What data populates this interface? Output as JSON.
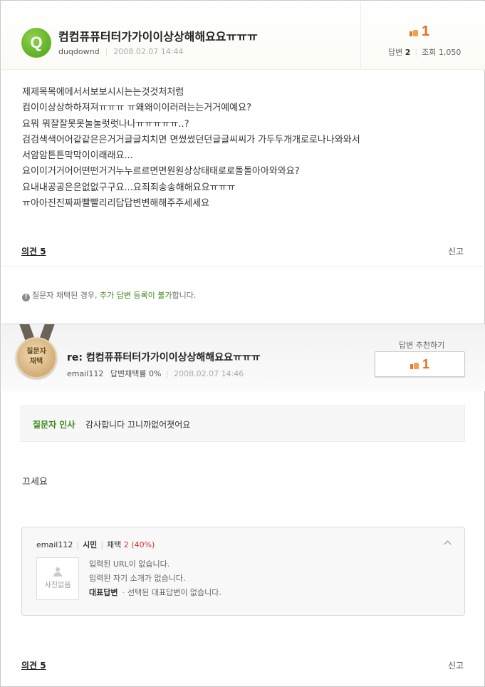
{
  "question": {
    "badge": "Q",
    "title": "컴컴퓨퓨터터가가이이상상해해요요ㅠㅠㅠ",
    "author": "duqdownd",
    "date": "2008.02.07 14:44",
    "likes": "1",
    "answers_label": "답변",
    "answers_count": "2",
    "views_label": "조회",
    "views_count": "1,050",
    "body": [
      "제제목목에에서서보보시시는는것것처처럼",
      "컴이이상상하하져져ㅠㅠㅠ ㅠ왜왜이이러러는는거거예예요?",
      "요뭐 뭐잘잘못못눌눌럿럿나나ㅠㅠㅠㅠㅠ..?",
      "검검색색어어같같은은거거글글치치면 면썼썼던던글글씨씨가 가두두개개로로나나와와서",
      "서암암튼튼막막이이래래요...",
      "요이이거거어어떤떤거거누누르르면면원원상상태태로로돌돌아아와와요?",
      "요내내공공은은없없구구요...요죄죄송송해해요요ㅠㅠㅠ",
      "ㅠ아아진진짜짜빨빨리리답답변변해해주주세세요"
    ],
    "opinion_label": "의견",
    "opinion_count": "5",
    "report_label": "신고"
  },
  "notice": {
    "prefix": "질문자 채택된 경우, ",
    "highlight": "추가 답변 등록이 불가",
    "suffix": "합니다."
  },
  "answer": {
    "medal_line1": "질문자",
    "medal_line2": "채택",
    "title": "re: 컴컴퓨퓨터터가가이이상상해해요요ㅠㅠㅠ",
    "author": "email112",
    "adoption_rate": "답변채택률 0%",
    "date": "2008.02.07 14:46",
    "recommend_label": "답변 추천하기",
    "recommend_count": "1",
    "greeting_label": "질문자 인사",
    "greeting_text": "감사합니다 끄니까없어졋어요",
    "body": "끄세요",
    "opinion_label": "의견",
    "opinion_count": "5",
    "report_label": "신고"
  },
  "profile": {
    "name": "email112",
    "rank": "시민",
    "adopt_label": "채택",
    "adopt_value": "2 (40%)",
    "photo_text": "사진없음",
    "url_text": "입력된 URL이 없습니다.",
    "intro_text": "입력된 자기 소개가 없습니다.",
    "rep_label": "대표답변",
    "rep_text": "선택된 대표답변이 없습니다."
  },
  "colors": {
    "accent_green": "#3b8a1e",
    "like_orange": "#e26e22",
    "adopt_red": "#d32f2f"
  }
}
